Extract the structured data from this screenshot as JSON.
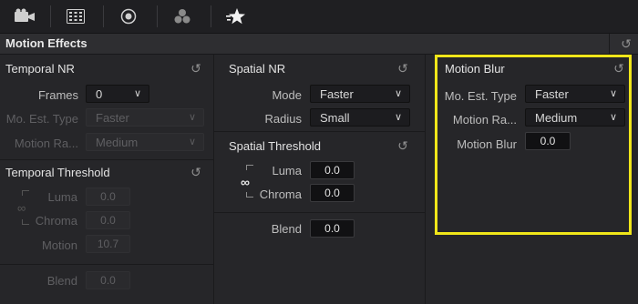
{
  "header": {
    "title": "Motion Effects"
  },
  "toolbar": {
    "icons": [
      "camera-icon",
      "clip-grid-icon",
      "record-target-icon",
      "color-dots-icon",
      "effects-star-icon"
    ]
  },
  "temporal_nr": {
    "title": "Temporal NR",
    "frames_label": "Frames",
    "frames_value": "0",
    "mo_est_label": "Mo. Est. Type",
    "mo_est_value": "Faster",
    "motion_range_label": "Motion Ra...",
    "motion_range_value": "Medium"
  },
  "temporal_threshold": {
    "title": "Temporal Threshold",
    "luma_label": "Luma",
    "luma_value": "0.0",
    "chroma_label": "Chroma",
    "chroma_value": "0.0",
    "motion_label": "Motion",
    "motion_value": "10.7",
    "blend_label": "Blend",
    "blend_value": "0.0"
  },
  "spatial_nr": {
    "title": "Spatial NR",
    "mode_label": "Mode",
    "mode_value": "Faster",
    "radius_label": "Radius",
    "radius_value": "Small"
  },
  "spatial_threshold": {
    "title": "Spatial Threshold",
    "luma_label": "Luma",
    "luma_value": "0.0",
    "chroma_label": "Chroma",
    "chroma_value": "0.0",
    "blend_label": "Blend",
    "blend_value": "0.0"
  },
  "motion_blur": {
    "title": "Motion Blur",
    "mo_est_label": "Mo. Est. Type",
    "mo_est_value": "Faster",
    "motion_range_label": "Motion Ra...",
    "motion_range_value": "Medium",
    "blur_label": "Motion Blur",
    "blur_value": "0.0"
  },
  "colors": {
    "highlight": "#f0e61a",
    "background": "#262629"
  }
}
